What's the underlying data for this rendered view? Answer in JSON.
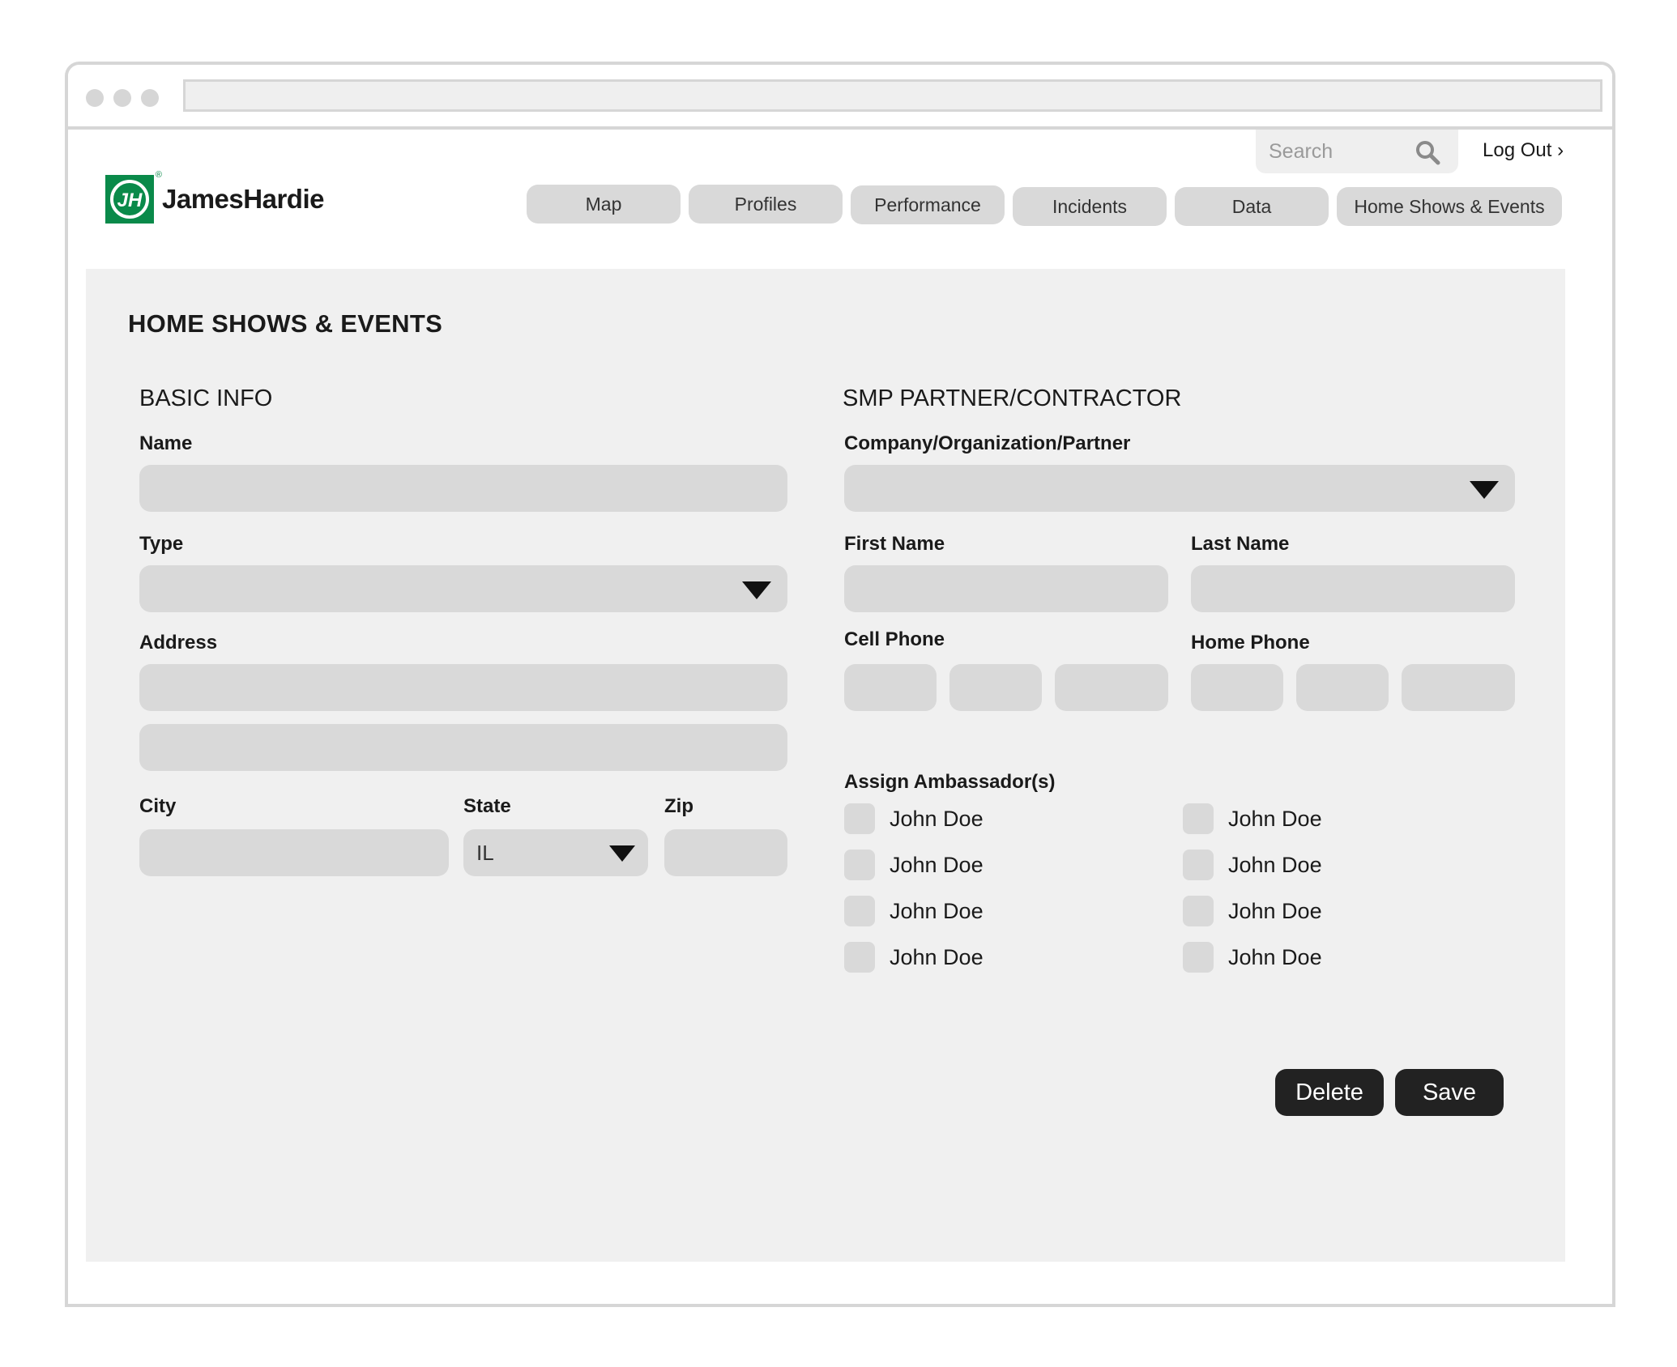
{
  "header": {
    "logo_text": "JamesHardie",
    "logo_mark": "jh-logo",
    "search_placeholder": "Search",
    "logout_label": "Log Out ›"
  },
  "nav": {
    "tabs": [
      "Map",
      "Profiles",
      "Performance",
      "Incidents",
      "Data",
      "Home Shows & Events"
    ]
  },
  "page": {
    "title": "HOME SHOWS & EVENTS"
  },
  "basic_info": {
    "section_title": "BASIC INFO",
    "name_label": "Name",
    "name_value": "",
    "type_label": "Type",
    "type_value": "",
    "address_label": "Address",
    "address_line1": "",
    "address_line2": "",
    "city_label": "City",
    "city_value": "",
    "state_label": "State",
    "state_value": "IL",
    "zip_label": "Zip",
    "zip_value": ""
  },
  "partner": {
    "section_title": "SMP PARTNER/CONTRACTOR",
    "company_label": "Company/Organization/Partner",
    "company_value": "",
    "first_name_label": "First Name",
    "last_name_label": "Last Name",
    "cell_phone_label": "Cell Phone",
    "home_phone_label": "Home Phone"
  },
  "ambassadors": {
    "label": "Assign Ambassador(s)",
    "items": [
      {
        "name": "John Doe",
        "checked": false
      },
      {
        "name": "John Doe",
        "checked": false
      },
      {
        "name": "John Doe",
        "checked": false
      },
      {
        "name": "John Doe",
        "checked": false
      },
      {
        "name": "John Doe",
        "checked": false
      },
      {
        "name": "John Doe",
        "checked": false
      },
      {
        "name": "John Doe",
        "checked": false
      },
      {
        "name": "John Doe",
        "checked": false
      }
    ]
  },
  "actions": {
    "delete_label": "Delete",
    "save_label": "Save"
  },
  "colors": {
    "brand_green": "#0a8a4a",
    "field_gray": "#d9d9d9",
    "panel_bg": "#f0f0f0",
    "button_dark": "#222222"
  }
}
